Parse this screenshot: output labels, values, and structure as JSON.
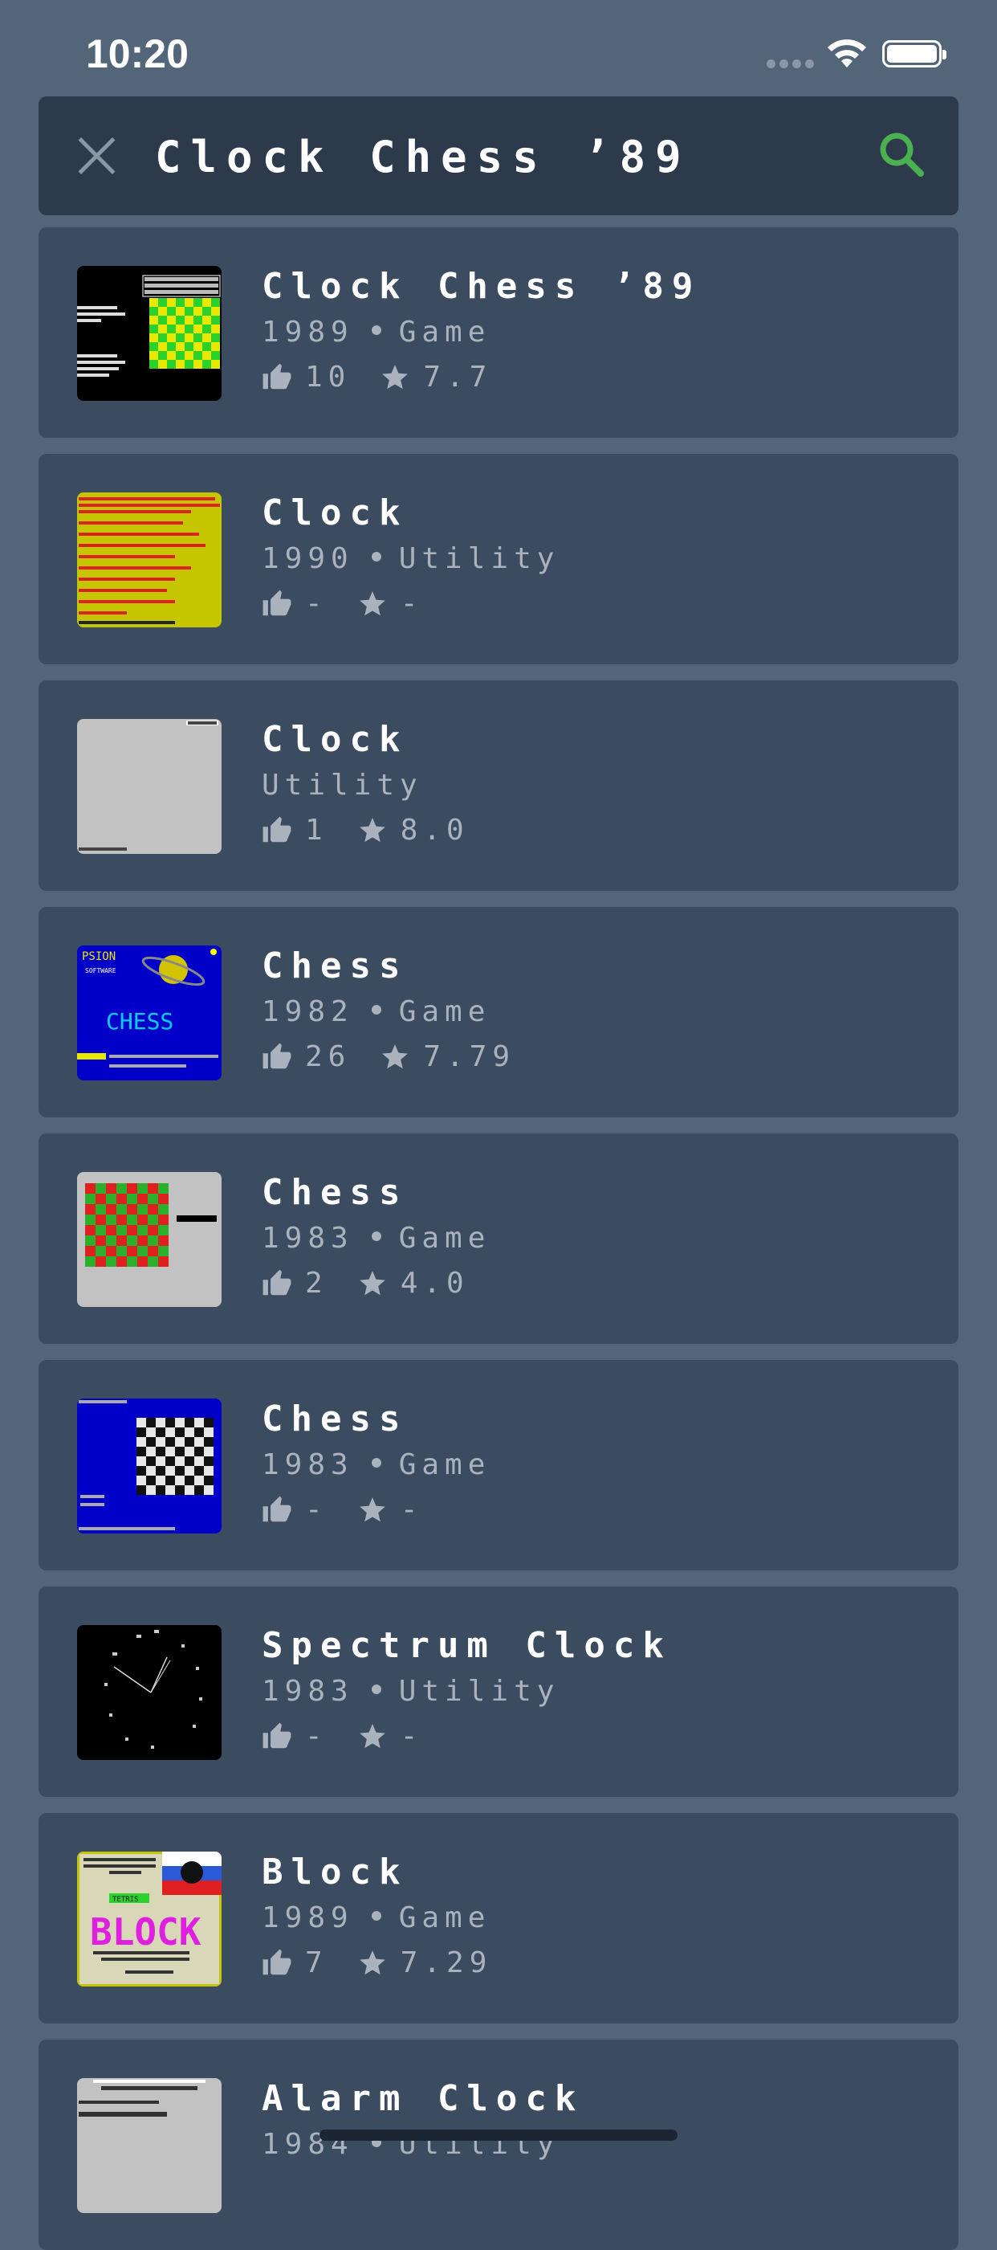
{
  "status_bar": {
    "time": "10:20"
  },
  "search": {
    "query": "Clock Chess ’89"
  },
  "colors": {
    "background": "#536579",
    "card": "#3c4c60",
    "search_bar": "#2d3a4c",
    "accent_green": "#4bb04f",
    "muted_text": "#a9b2bd"
  },
  "results": [
    {
      "title": "Clock Chess ’89",
      "year": "1989",
      "category": "Game",
      "likes": "10",
      "rating": "7.7",
      "thumb": "chess-clock-screen"
    },
    {
      "title": "Clock",
      "year": "1990",
      "category": "Utility",
      "likes": "-",
      "rating": "-",
      "thumb": "yellow-text-screen"
    },
    {
      "title": "Clock",
      "year": "",
      "category": "Utility",
      "likes": "1",
      "rating": "8.0",
      "thumb": "grey-screen"
    },
    {
      "title": "Chess",
      "year": "1982",
      "category": "Game",
      "likes": "26",
      "rating": "7.79",
      "thumb": "psion-chess-screen"
    },
    {
      "title": "Chess",
      "year": "1983",
      "category": "Game",
      "likes": "2",
      "rating": "4.0",
      "thumb": "red-green-board-screen"
    },
    {
      "title": "Chess",
      "year": "1983",
      "category": "Game",
      "likes": "-",
      "rating": "-",
      "thumb": "blue-board-screen"
    },
    {
      "title": "Spectrum Clock",
      "year": "1983",
      "category": "Utility",
      "likes": "-",
      "rating": "-",
      "thumb": "clock-face-screen"
    },
    {
      "title": "Block",
      "year": "1989",
      "category": "Game",
      "likes": "7",
      "rating": "7.29",
      "thumb": "block-title-screen"
    },
    {
      "title": "Alarm Clock",
      "year": "1984",
      "category": "Utility",
      "likes": "",
      "rating": "",
      "thumb": "alarm-clock-screen"
    }
  ],
  "thumb_text": {
    "psion": "PSION",
    "software": "SOFTWARE",
    "chess": "CHESS",
    "block": "BLOCK",
    "tetris": "TETRIS"
  }
}
